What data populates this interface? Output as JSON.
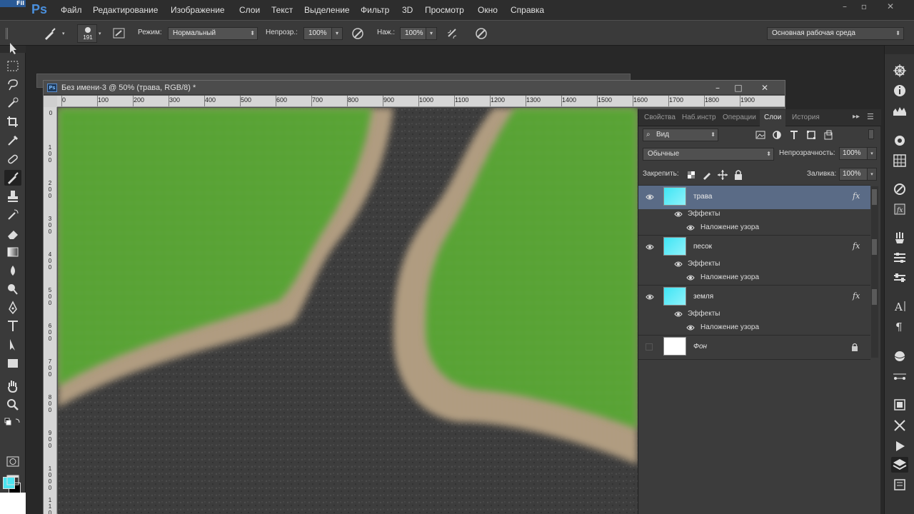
{
  "app": {
    "logo": "Ps",
    "corner_tag": "Fil"
  },
  "menu": [
    {
      "label": "Файл"
    },
    {
      "label": "Редактирование"
    },
    {
      "label": "Изображение"
    },
    {
      "label": "Слои"
    },
    {
      "label": "Текст"
    },
    {
      "label": "Выделение"
    },
    {
      "label": "Фильтр"
    },
    {
      "label": "3D"
    },
    {
      "label": "Просмотр"
    },
    {
      "label": "Окно"
    },
    {
      "label": "Справка"
    }
  ],
  "window_controls": {
    "minimize": "–",
    "restore": "▫",
    "close": "✕"
  },
  "options": {
    "brush_size": "191",
    "mode_label": "Режим:",
    "mode_value": "Нормальный",
    "opacity_label": "Непрозр.:",
    "opacity_value": "100%",
    "pressure_label": "Наж.:",
    "pressure_value": "100%",
    "workspace": "Основная рабочая среда"
  },
  "document": {
    "title": "Без имени-3 @ 50% (трава, RGB/8) *",
    "icon_text": "Ps",
    "controls": {
      "minimize": "–",
      "maximize": "□",
      "close": "✕"
    },
    "ruler_h": [
      "0",
      "100",
      "200",
      "300",
      "400",
      "500",
      "600",
      "700",
      "800",
      "900",
      "1000",
      "1100",
      "1200",
      "1300",
      "1400",
      "1500",
      "1600",
      "1700",
      "1800",
      "1900"
    ],
    "ruler_v": [
      "0",
      "100",
      "200",
      "300",
      "400",
      "500",
      "600",
      "700",
      "800",
      "900",
      "1000",
      "1100"
    ]
  },
  "panel": {
    "tabs": [
      "Свойства",
      "Наб.инстр",
      "Операции",
      "Слои",
      "История"
    ],
    "active_tab": "Слои",
    "filter_kind": "Вид",
    "blend_mode": "Обычные",
    "opacity_label": "Непрозрачность:",
    "opacity_value": "100%",
    "lock_label": "Закрепить:",
    "fill_label": "Заливка:",
    "fill_value": "100%",
    "effects_label": "Эффекты",
    "pattern_label": "Наложение узора",
    "fx": "fx",
    "layers": [
      {
        "name": "трава",
        "selected": true,
        "thumb": "#3fe5f5"
      },
      {
        "name": "песок",
        "selected": false,
        "thumb": "#3fe5f5"
      },
      {
        "name": "земля",
        "selected": false,
        "thumb": "#3fe5f5"
      },
      {
        "name": "Фон",
        "selected": false,
        "thumb": "#ffffff"
      }
    ]
  },
  "colors": {
    "foreground": "#4de4f0",
    "background": "#000000",
    "grass": "#4c9a2e",
    "sand": "#a89478",
    "soil": "#3e3e3e",
    "selection": "#5a6b86"
  }
}
